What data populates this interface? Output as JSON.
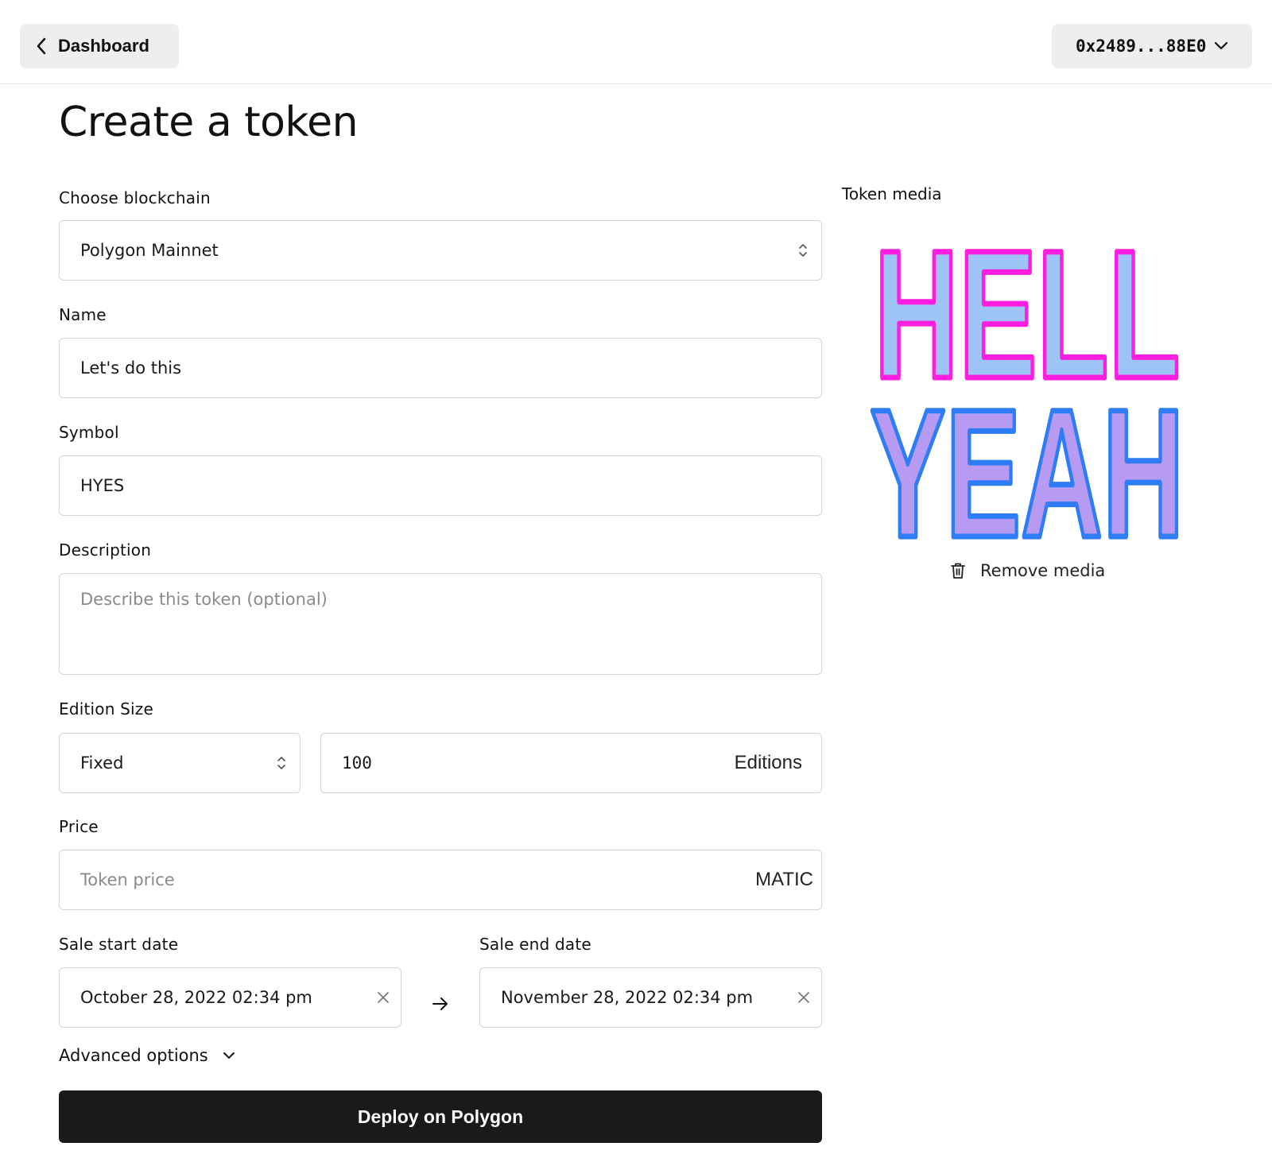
{
  "header": {
    "back_label": "Dashboard",
    "wallet_address": "0x2489...88E0"
  },
  "page": {
    "title": "Create a token"
  },
  "form": {
    "blockchain": {
      "label": "Choose blockchain",
      "value": "Polygon Mainnet"
    },
    "name": {
      "label": "Name",
      "value": "Let's do this"
    },
    "symbol": {
      "label": "Symbol",
      "value": "HYES"
    },
    "description": {
      "label": "Description",
      "placeholder": "Describe this token (optional)"
    },
    "edition_size": {
      "label": "Edition Size",
      "type_value": "Fixed",
      "count_value": "100",
      "suffix": "Editions"
    },
    "price": {
      "label": "Price",
      "placeholder": "Token price",
      "currency": "MATIC"
    },
    "sale_start": {
      "label": "Sale start date",
      "value": "October 28, 2022 02:34 pm"
    },
    "sale_end": {
      "label": "Sale end date",
      "value": "November 28, 2022 02:34 pm"
    },
    "advanced_label": "Advanced options",
    "deploy_label": "Deploy on Polygon"
  },
  "media": {
    "label": "Token media",
    "image_text_line1": "HELL",
    "image_text_line2": "YEAH",
    "remove_label": "Remove media",
    "colors": {
      "fill_top": "#9ec3f7",
      "stroke_top": "#ff1ee0",
      "fill_bottom": "#b79af2",
      "stroke_bottom": "#2f7df6"
    }
  },
  "icons": [
    "chevron-left-icon",
    "chevron-down-icon",
    "stepper-icon",
    "close-icon",
    "arrow-right-icon",
    "trash-icon"
  ]
}
